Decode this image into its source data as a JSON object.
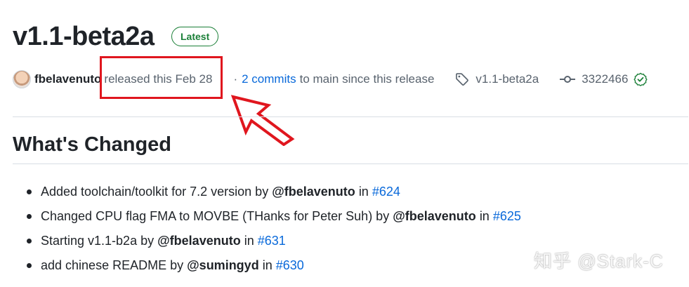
{
  "release": {
    "title": "v1.1-beta2a",
    "badge": "Latest",
    "author": "fbelavenuto",
    "released_text": "released this Feb 28",
    "separator": "·",
    "commits_link": "2 commits",
    "commits_rest": "to main since this release",
    "tag": "v1.1-beta2a",
    "commit_sha": "3322466"
  },
  "section": {
    "heading": "What's Changed"
  },
  "changes": [
    {
      "text": "Added toolchain/toolkit for 7.2 version by",
      "mention": "@fbelavenuto",
      "in": "in",
      "pr": "#624"
    },
    {
      "text": "Changed CPU flag FMA to MOVBE (THanks for Peter Suh) by",
      "mention": "@fbelavenuto",
      "in": "in",
      "pr": "#625"
    },
    {
      "text": "Starting v1.1-b2a by",
      "mention": "@fbelavenuto",
      "in": "in",
      "pr": "#631"
    },
    {
      "text": "add chinese README by",
      "mention": "@sumingyd",
      "in": "in",
      "pr": "#630"
    }
  ],
  "watermark": "知乎 @Stark-C",
  "icons": {
    "avatar": "avatar",
    "tag": "tag-icon",
    "commit": "git-commit-icon",
    "verified": "check-circle-icon"
  },
  "colors": {
    "link": "#0969da",
    "badge": "#1a7f37",
    "annotation": "#e0161e"
  }
}
